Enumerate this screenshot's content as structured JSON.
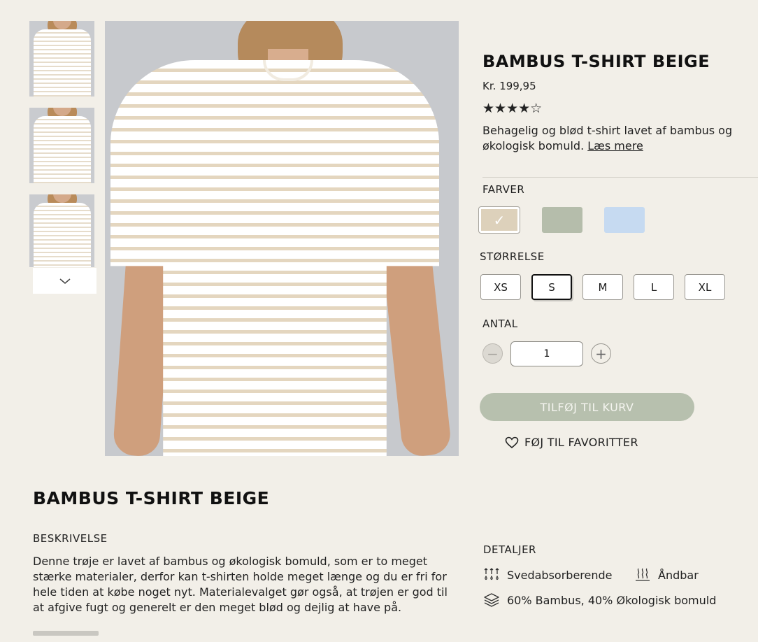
{
  "product": {
    "title": "BAMBUS T-SHIRT BEIGE",
    "price": "Kr. 199,95",
    "rating": {
      "value": 4,
      "max": 5,
      "stars": "★★★★☆"
    },
    "short_description": "Behagelig og blød t-shirt lavet af bambus og økologisk bomuld.",
    "read_more": "Læs mere"
  },
  "gallery": {
    "thumbnails": [
      "thumb-1",
      "thumb-2",
      "thumb-3"
    ],
    "scroll_icon": "chevron-down-icon"
  },
  "colors": {
    "label": "FARVER",
    "options": [
      {
        "name": "beige",
        "hex": "#ddd1bb",
        "selected": true
      },
      {
        "name": "green",
        "hex": "#b5bdab",
        "selected": false
      },
      {
        "name": "blue",
        "hex": "#c6daf1",
        "selected": false
      }
    ],
    "check_icon": "✓"
  },
  "sizes": {
    "label": "STØRRELSE",
    "options": [
      "XS",
      "S",
      "M",
      "L",
      "XL"
    ],
    "selected": "S"
  },
  "quantity": {
    "label": "ANTAL",
    "value": "1",
    "minus": "−",
    "plus": "+"
  },
  "actions": {
    "add_to_cart": "TILFØJ TIL KURV",
    "add_to_favorites": "FØJ TIL FAVORITTER"
  },
  "details_section": {
    "title": "BAMBUS T-SHIRT BEIGE",
    "description_label": "BESKRIVELSE",
    "description": "Denne trøje er lavet af bambus og økologisk bomuld, som er to meget stærke materialer, derfor kan t-shirten holde meget længe og du er fri for hele tiden at købe noget nyt. Materialevalget gør også, at trøjen er god til at afgive fugt og generelt er den meget blød og dejlig at have på.",
    "details_label": "DETALJER",
    "features": [
      {
        "icon": "sweat-icon",
        "label": "Svedabsorberende"
      },
      {
        "icon": "breathable-icon",
        "label": "Åndbar"
      },
      {
        "icon": "fabric-icon",
        "label": "60% Bambus, 40% Økologisk bomuld"
      }
    ]
  },
  "colors_palette": {
    "background": "#f2efe8",
    "accent_button": "#b7c0ae"
  }
}
